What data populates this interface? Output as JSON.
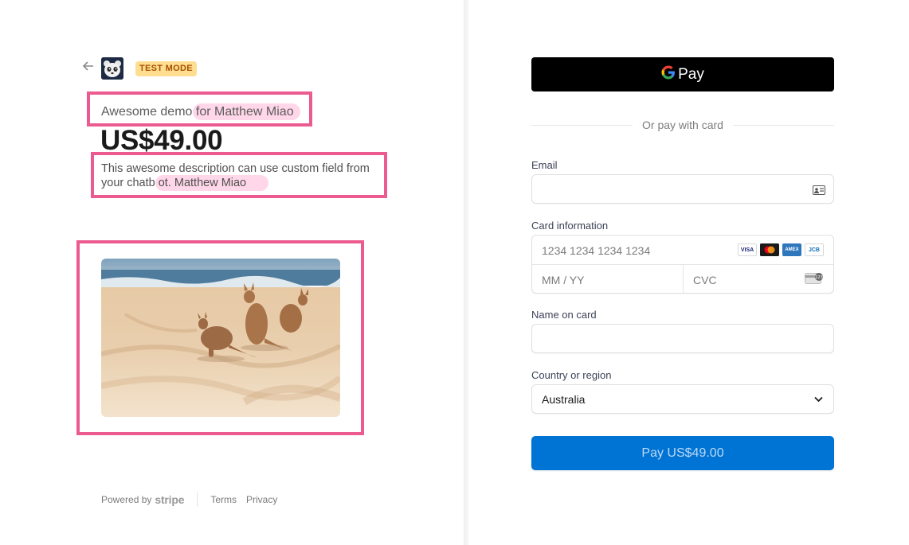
{
  "header": {
    "badge": "TEST MODE"
  },
  "product": {
    "name_prefix": "Awesome demo ",
    "name_highlight": "for Matthew Miao",
    "price": "US$49.00",
    "description_prefix": "This awesome description can use custom field from your chatb",
    "description_highlight": "ot. Matthew Miao"
  },
  "footer": {
    "powered_by": "Powered by",
    "stripe": "stripe",
    "terms": "Terms",
    "privacy": "Privacy"
  },
  "payment": {
    "gpay_label": "Pay",
    "or_text": "Or pay with card",
    "email_label": "Email",
    "card_label": "Card information",
    "card_number_placeholder": "1234 1234 1234 1234",
    "expiry_placeholder": "MM / YY",
    "cvc_placeholder": "CVC",
    "brands": [
      "VISA",
      "MC",
      "AMEX",
      "JCB"
    ],
    "name_label": "Name on card",
    "country_label": "Country or region",
    "country_value": "Australia",
    "pay_button": "Pay US$49.00"
  },
  "colors": {
    "accent": "#0074d4",
    "annotation": "#ec5b8f",
    "badge_bg": "#ffde92",
    "badge_text": "#a35200"
  },
  "icons": {
    "back": "arrow-left-icon",
    "contact": "contact-card-icon",
    "chevron": "chevron-down-icon"
  }
}
